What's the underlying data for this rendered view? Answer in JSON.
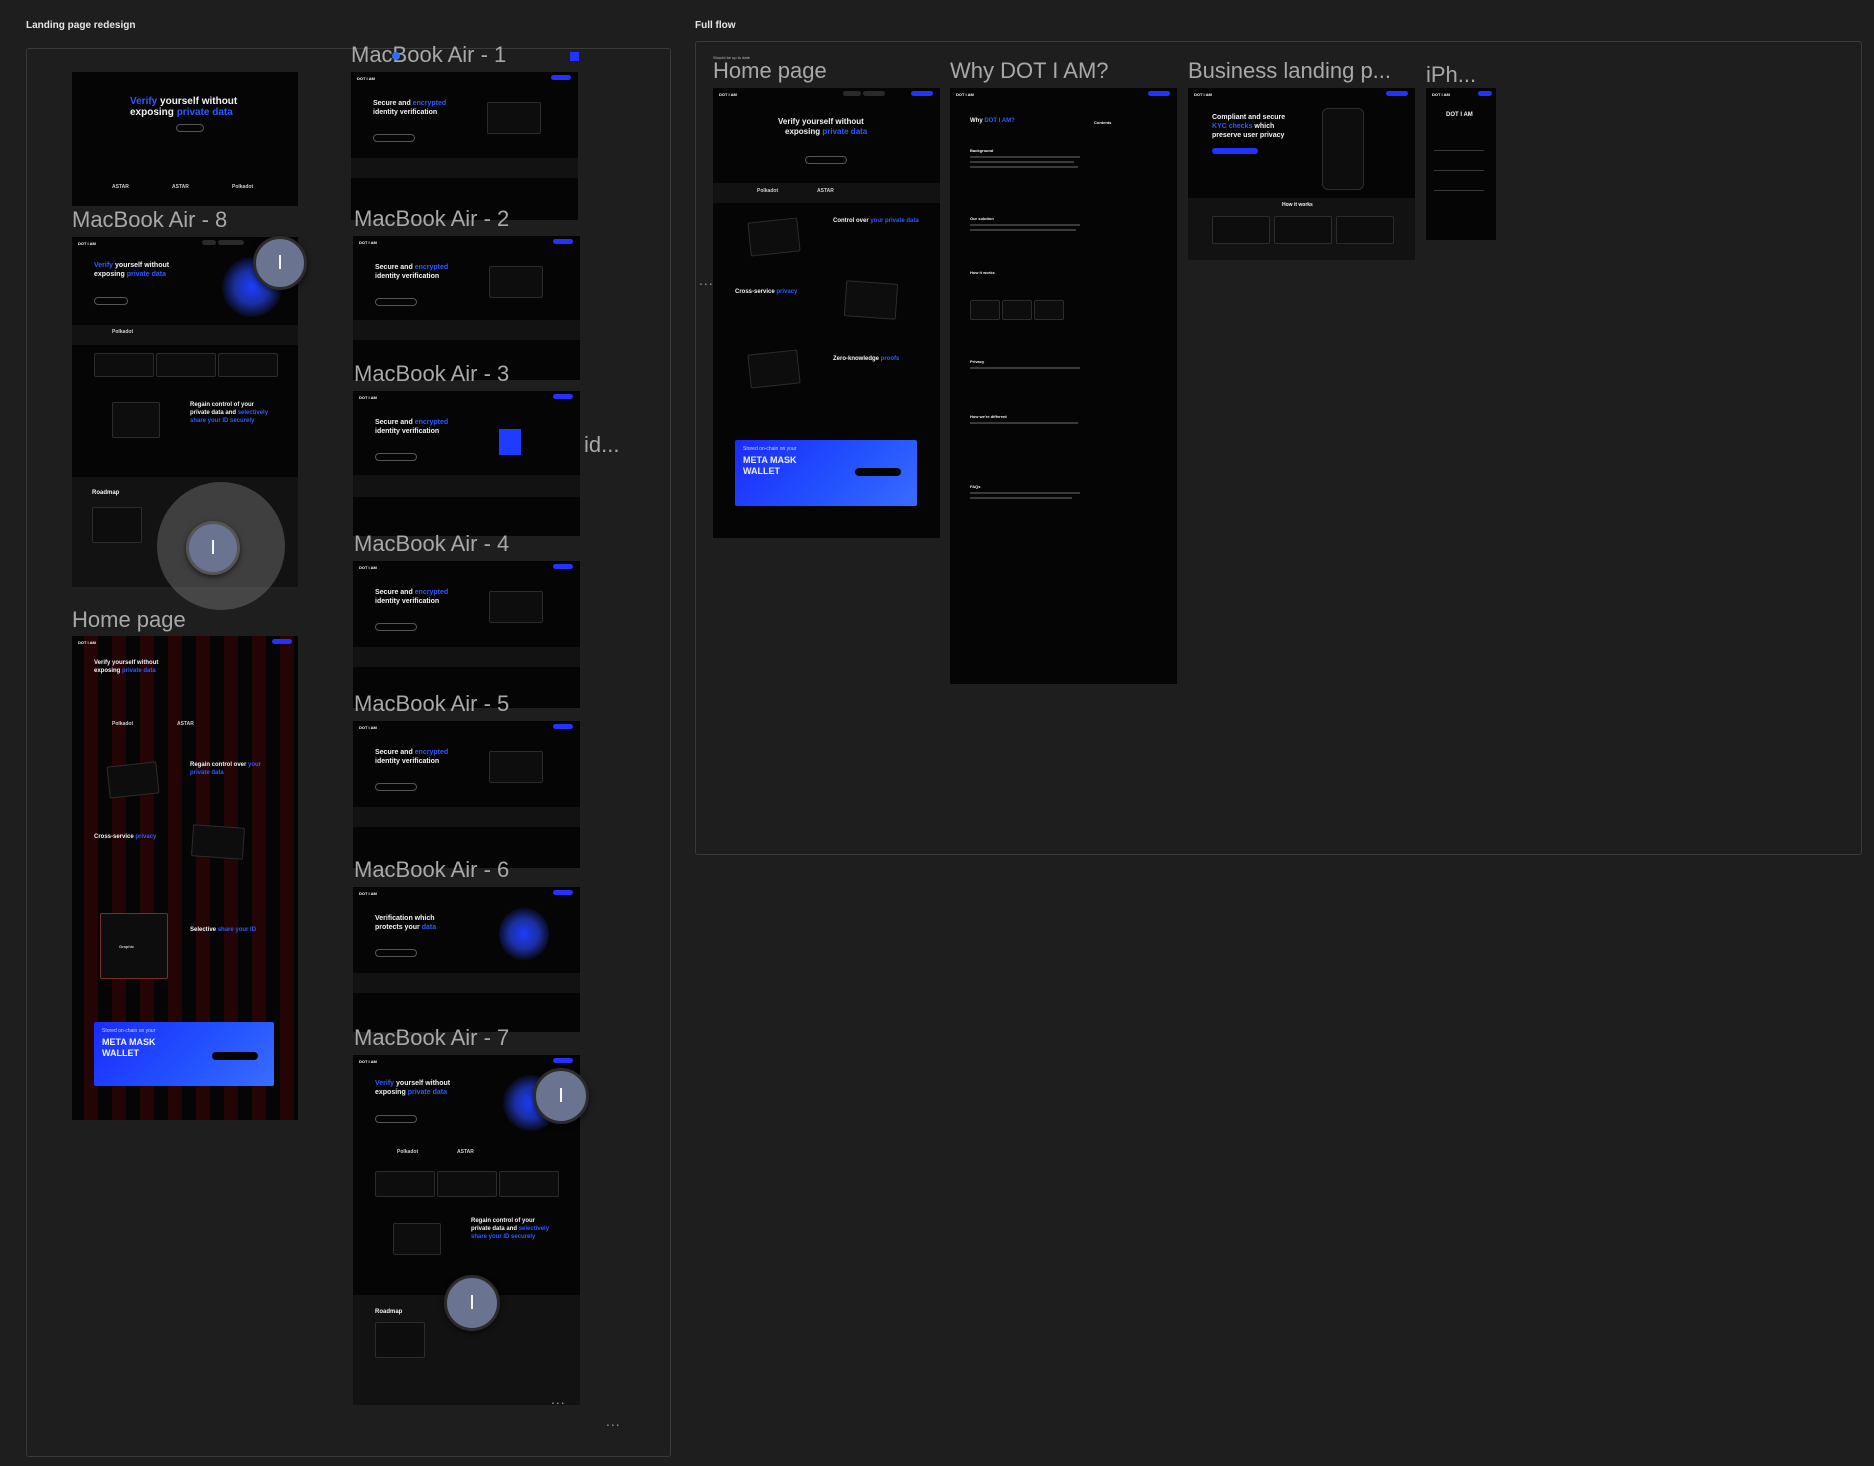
{
  "sections": {
    "landing": {
      "title": "Landing page redesign"
    },
    "flow": {
      "title": "Full flow",
      "note": "Should be up to date"
    }
  },
  "frames": {
    "air1": "MacBook Air - 1",
    "air8": "MacBook Air - 8",
    "air2": "MacBook Air - 2",
    "air3": "MacBook Air - 3",
    "air4": "MacBook Air - 4",
    "air5": "MacBook Air - 5",
    "air6": "MacBook Air - 6",
    "air7": "MacBook Air - 7",
    "home": "Home page",
    "flow_home": "Home page",
    "why": "Why DOT I AM?",
    "business": "Business landing p...",
    "iphone": "iPh...",
    "hidden": "id..."
  },
  "content": {
    "logo": "DOT I AM",
    "hero_verify": "Verify",
    "hero_rest1": " yourself without",
    "hero_rest2": "exposing ",
    "hero_private": "private data",
    "secure1": "Secure and ",
    "encrypted": "encrypted",
    "secure2": "identity verification",
    "verif1": "Verification which",
    "verif2": "protects your ",
    "verif_data": "data",
    "get_started": "Get started",
    "polkadot": "Polkadot",
    "astar": "ASTAR",
    "regain1": "Regain control of your",
    "regain2": "private data and ",
    "selectively": "selectively",
    "regain3": "share your ID securely",
    "regain_over1": "Regain control over ",
    "your_private": "your",
    "private_data_word": "private data",
    "control_over": "Control over ",
    "your_private_data": "your private data",
    "cross_service": "Cross-service ",
    "privacy_word": "privacy",
    "zero_knowledge": "Zero-knowledge ",
    "proofs": "proofs",
    "selective": "Selective ",
    "share_id": "share your ID",
    "graphic": "Graphic",
    "roadmap": "Roadmap",
    "meta_top": "Stored on-chain on your",
    "meta_line1": "META MASK",
    "meta_line2": "WALLET",
    "why_title_a": "Why ",
    "why_title_b": "DOT I AM?",
    "why_h": [
      "Background",
      "Our solution",
      "How it works",
      "Privacy",
      "How we're different",
      "FAQs"
    ],
    "contents": "Contents",
    "biz1": "Compliant and secure",
    "biz2": "KYC checks",
    "biz3": " which",
    "biz4": "preserve user privacy",
    "how_it_works": "How it works",
    "iphone_logo": "DOT I AM",
    "ellipsis": "..."
  },
  "colors": {
    "accent": "#2f5bff",
    "canvas": "#1e1e1e",
    "frame": "#050505"
  }
}
